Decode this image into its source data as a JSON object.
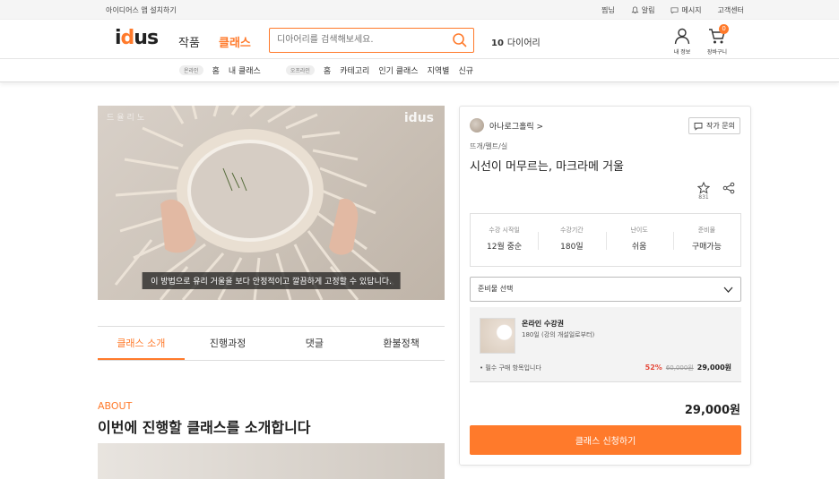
{
  "utility_bar": {
    "install": "아이디어스 앱 설치하기",
    "links": [
      "찜님",
      "알림",
      "메시지",
      "고객센터"
    ]
  },
  "header": {
    "logo": "idus",
    "nav_works": "작품",
    "nav_class": "클래스",
    "search_placeholder": "디아어리를 검색해보세요.",
    "keyword_rank": "10",
    "keyword_text": "다이어리",
    "my_info": "내 정보",
    "cart": "장바구니",
    "cart_count": "0"
  },
  "subnav": {
    "online_pill": "온라인",
    "online_items": [
      "홈",
      "내 클래스"
    ],
    "offline_pill": "오프라인",
    "offline_items": [
      "홈",
      "카테고리",
      "인기 클래스",
      "지역별",
      "신규"
    ]
  },
  "video": {
    "watermark": "idus",
    "watermark_left": "드율리노",
    "subtitle": "이 방법으로 유리 거울을 보다 안정적이고 깔끔하게 고정할 수 있답니다."
  },
  "tabs": [
    "클래스 소개",
    "진행과정",
    "댓글",
    "환불정책"
  ],
  "about": {
    "label": "ABOUT",
    "title": "이번에 진행할 클래스를 소개합니다"
  },
  "product": {
    "artist": "아나로그홀릭 >",
    "inquiry": "작가 문의",
    "category": "뜨개/펠트/실",
    "title": "시선이 머무르는, 마크라메 거울",
    "favorites": "831",
    "info": [
      {
        "label": "수강 시작일",
        "value": "12월 중순"
      },
      {
        "label": "수강기간",
        "value": "180일"
      },
      {
        "label": "난이도",
        "value": "쉬움"
      },
      {
        "label": "준비물",
        "value": "구매가능"
      }
    ],
    "select_label": "준비물 선택",
    "option": {
      "name": "온라인 수강권",
      "desc": "180일 (강의 개설일로부터)",
      "required": "• 필수 구매 항목입니다",
      "discount": "52%",
      "original": "60,000원",
      "price": "29,000원"
    },
    "total": "29,000원",
    "apply": "클래스 신청하기"
  },
  "colors": {
    "accent": "#ff7a2b",
    "discount": "#e5493a"
  }
}
